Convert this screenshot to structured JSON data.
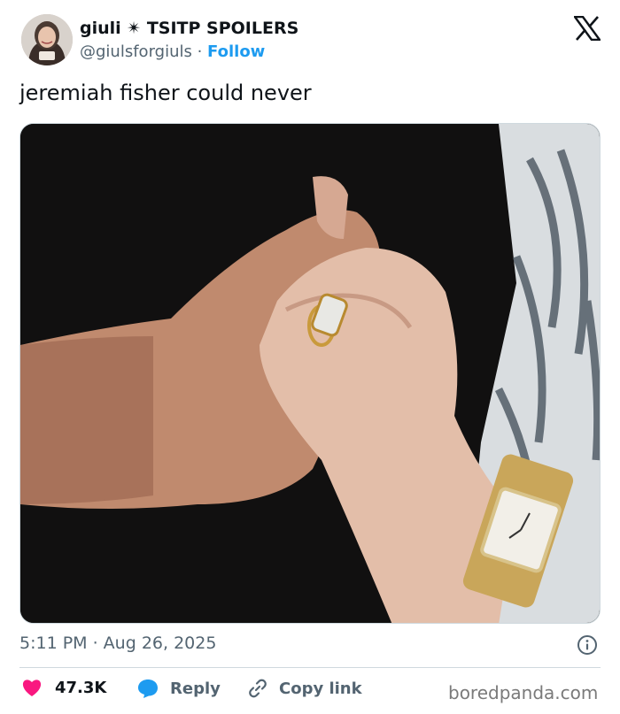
{
  "author": {
    "display_name": "giuli ✴ TSITP SPOILERS",
    "handle": "@giulsforgiuls",
    "separator": " · ",
    "follow_label": "Follow"
  },
  "tweet": {
    "text": "jeremiah fisher could never",
    "timestamp": "5:11 PM · Aug 26, 2025"
  },
  "actions": {
    "likes": "47.3K",
    "reply_label": "Reply",
    "copy_label": "Copy link"
  },
  "watermark": "boredpanda.com",
  "colors": {
    "like": "#f91880",
    "reply": "#1d9bf0",
    "follow": "#1d9bf0",
    "muted": "#536471"
  },
  "icons": [
    "x-logo-icon",
    "info-icon",
    "heart-icon",
    "reply-bubble-icon",
    "link-icon"
  ]
}
